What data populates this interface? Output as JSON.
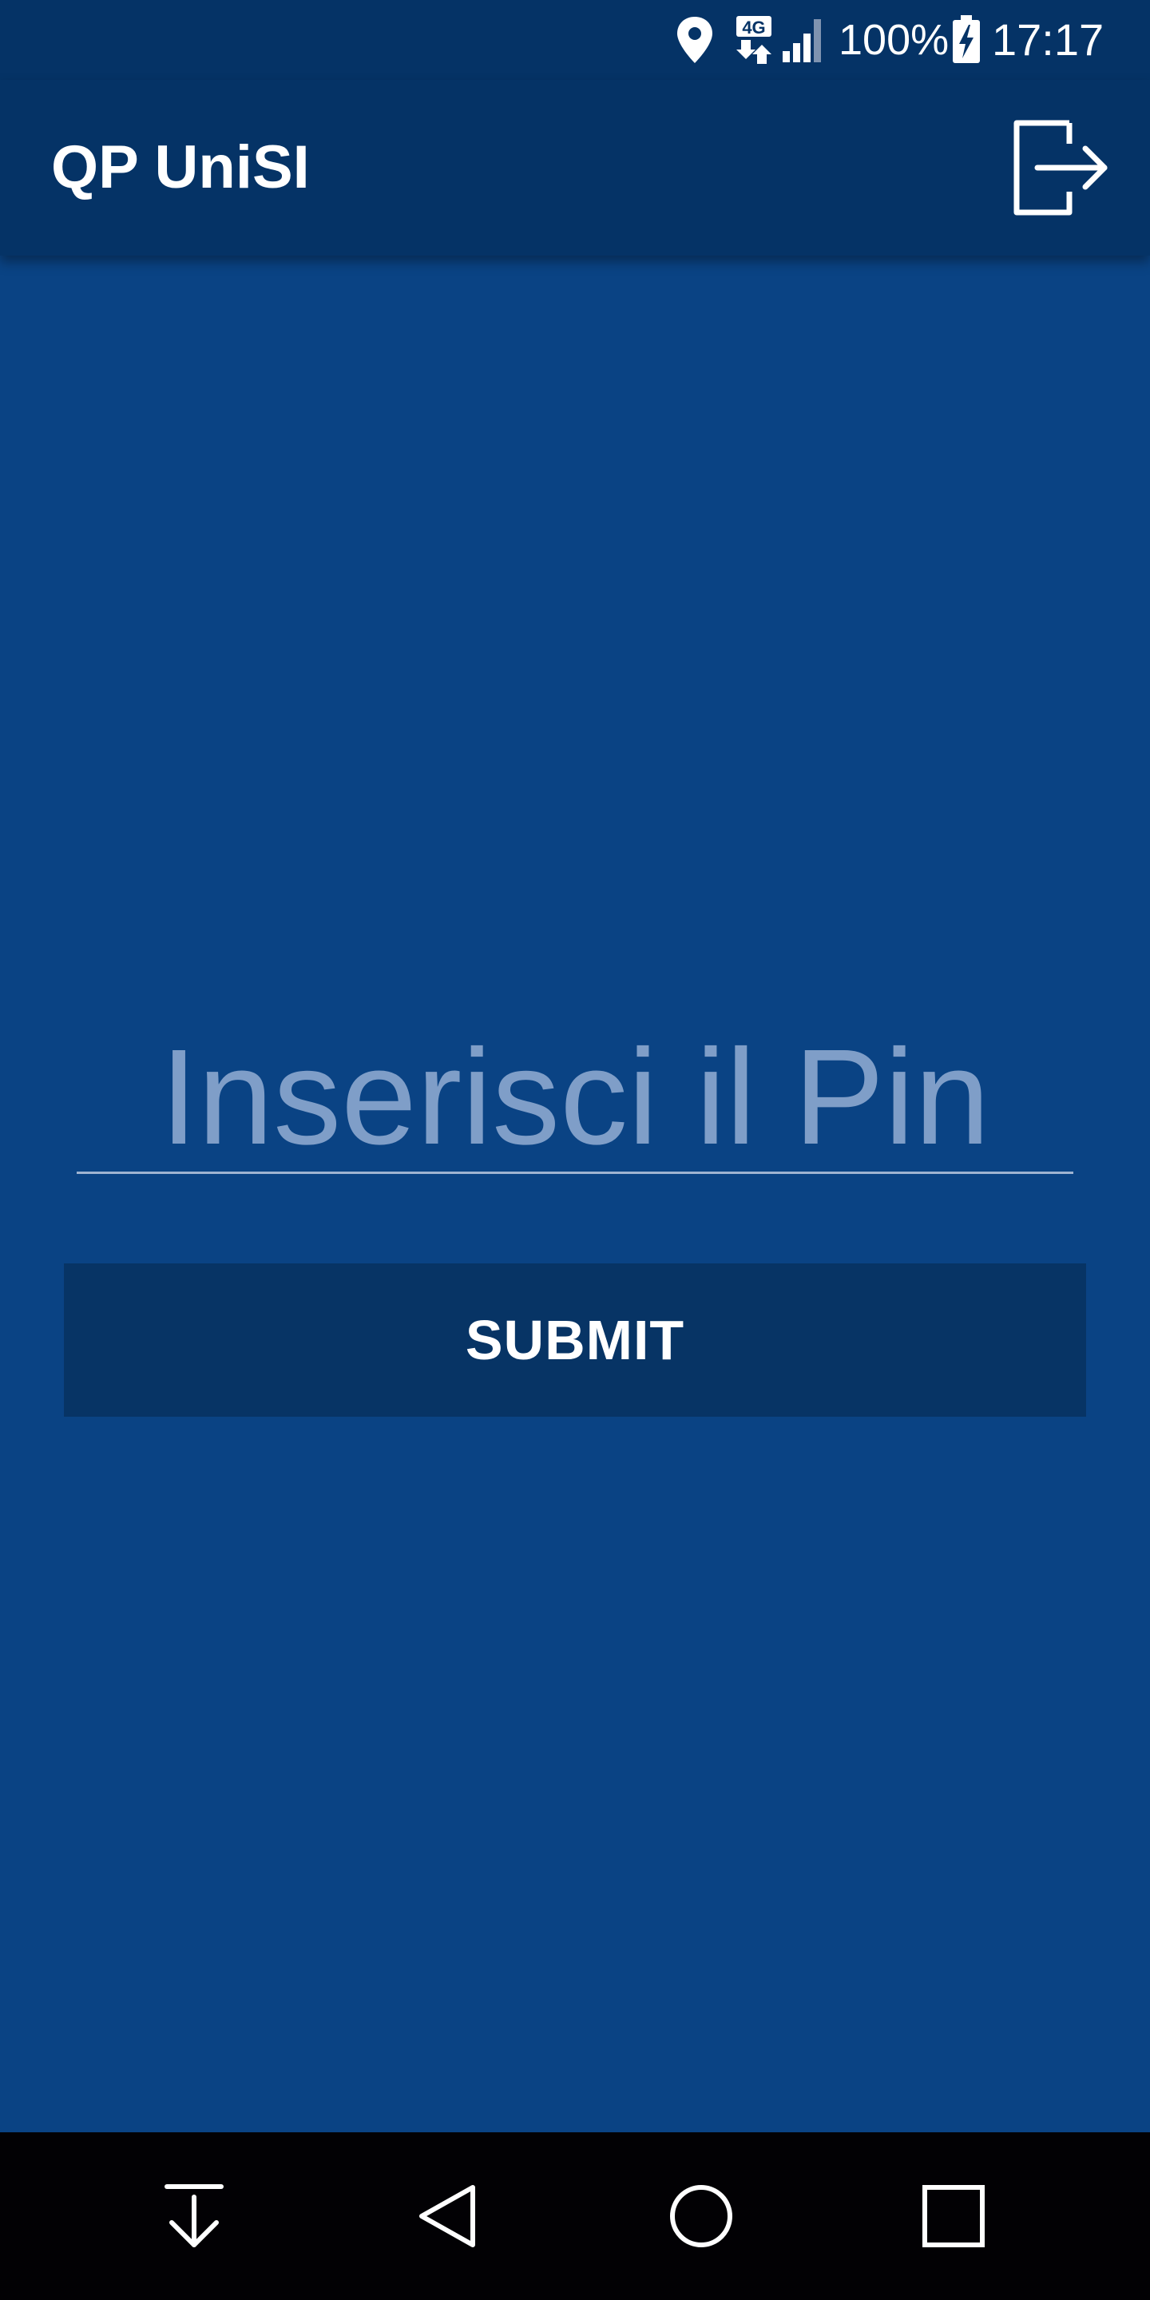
{
  "status_bar": {
    "icons": [
      "location-icon",
      "network-4g-icon",
      "signal-icon",
      "battery-charging-icon"
    ],
    "network_label": "4G",
    "battery_percent": "100%",
    "time": "17:17"
  },
  "app_bar": {
    "title": "QP UniSI",
    "action_icon": "logout-icon"
  },
  "pin_form": {
    "pin_placeholder": "Inserisci il Pin",
    "pin_value": "",
    "submit_label": "SUBMIT"
  },
  "nav_bar": {
    "icons": [
      "notification-pull-icon",
      "back-icon",
      "home-icon",
      "recents-icon"
    ]
  },
  "colors": {
    "background": "#0a4384",
    "app_bar": "#053366",
    "button": "#073465",
    "nav_bar": "#020104",
    "placeholder": "#7f9ec8"
  }
}
